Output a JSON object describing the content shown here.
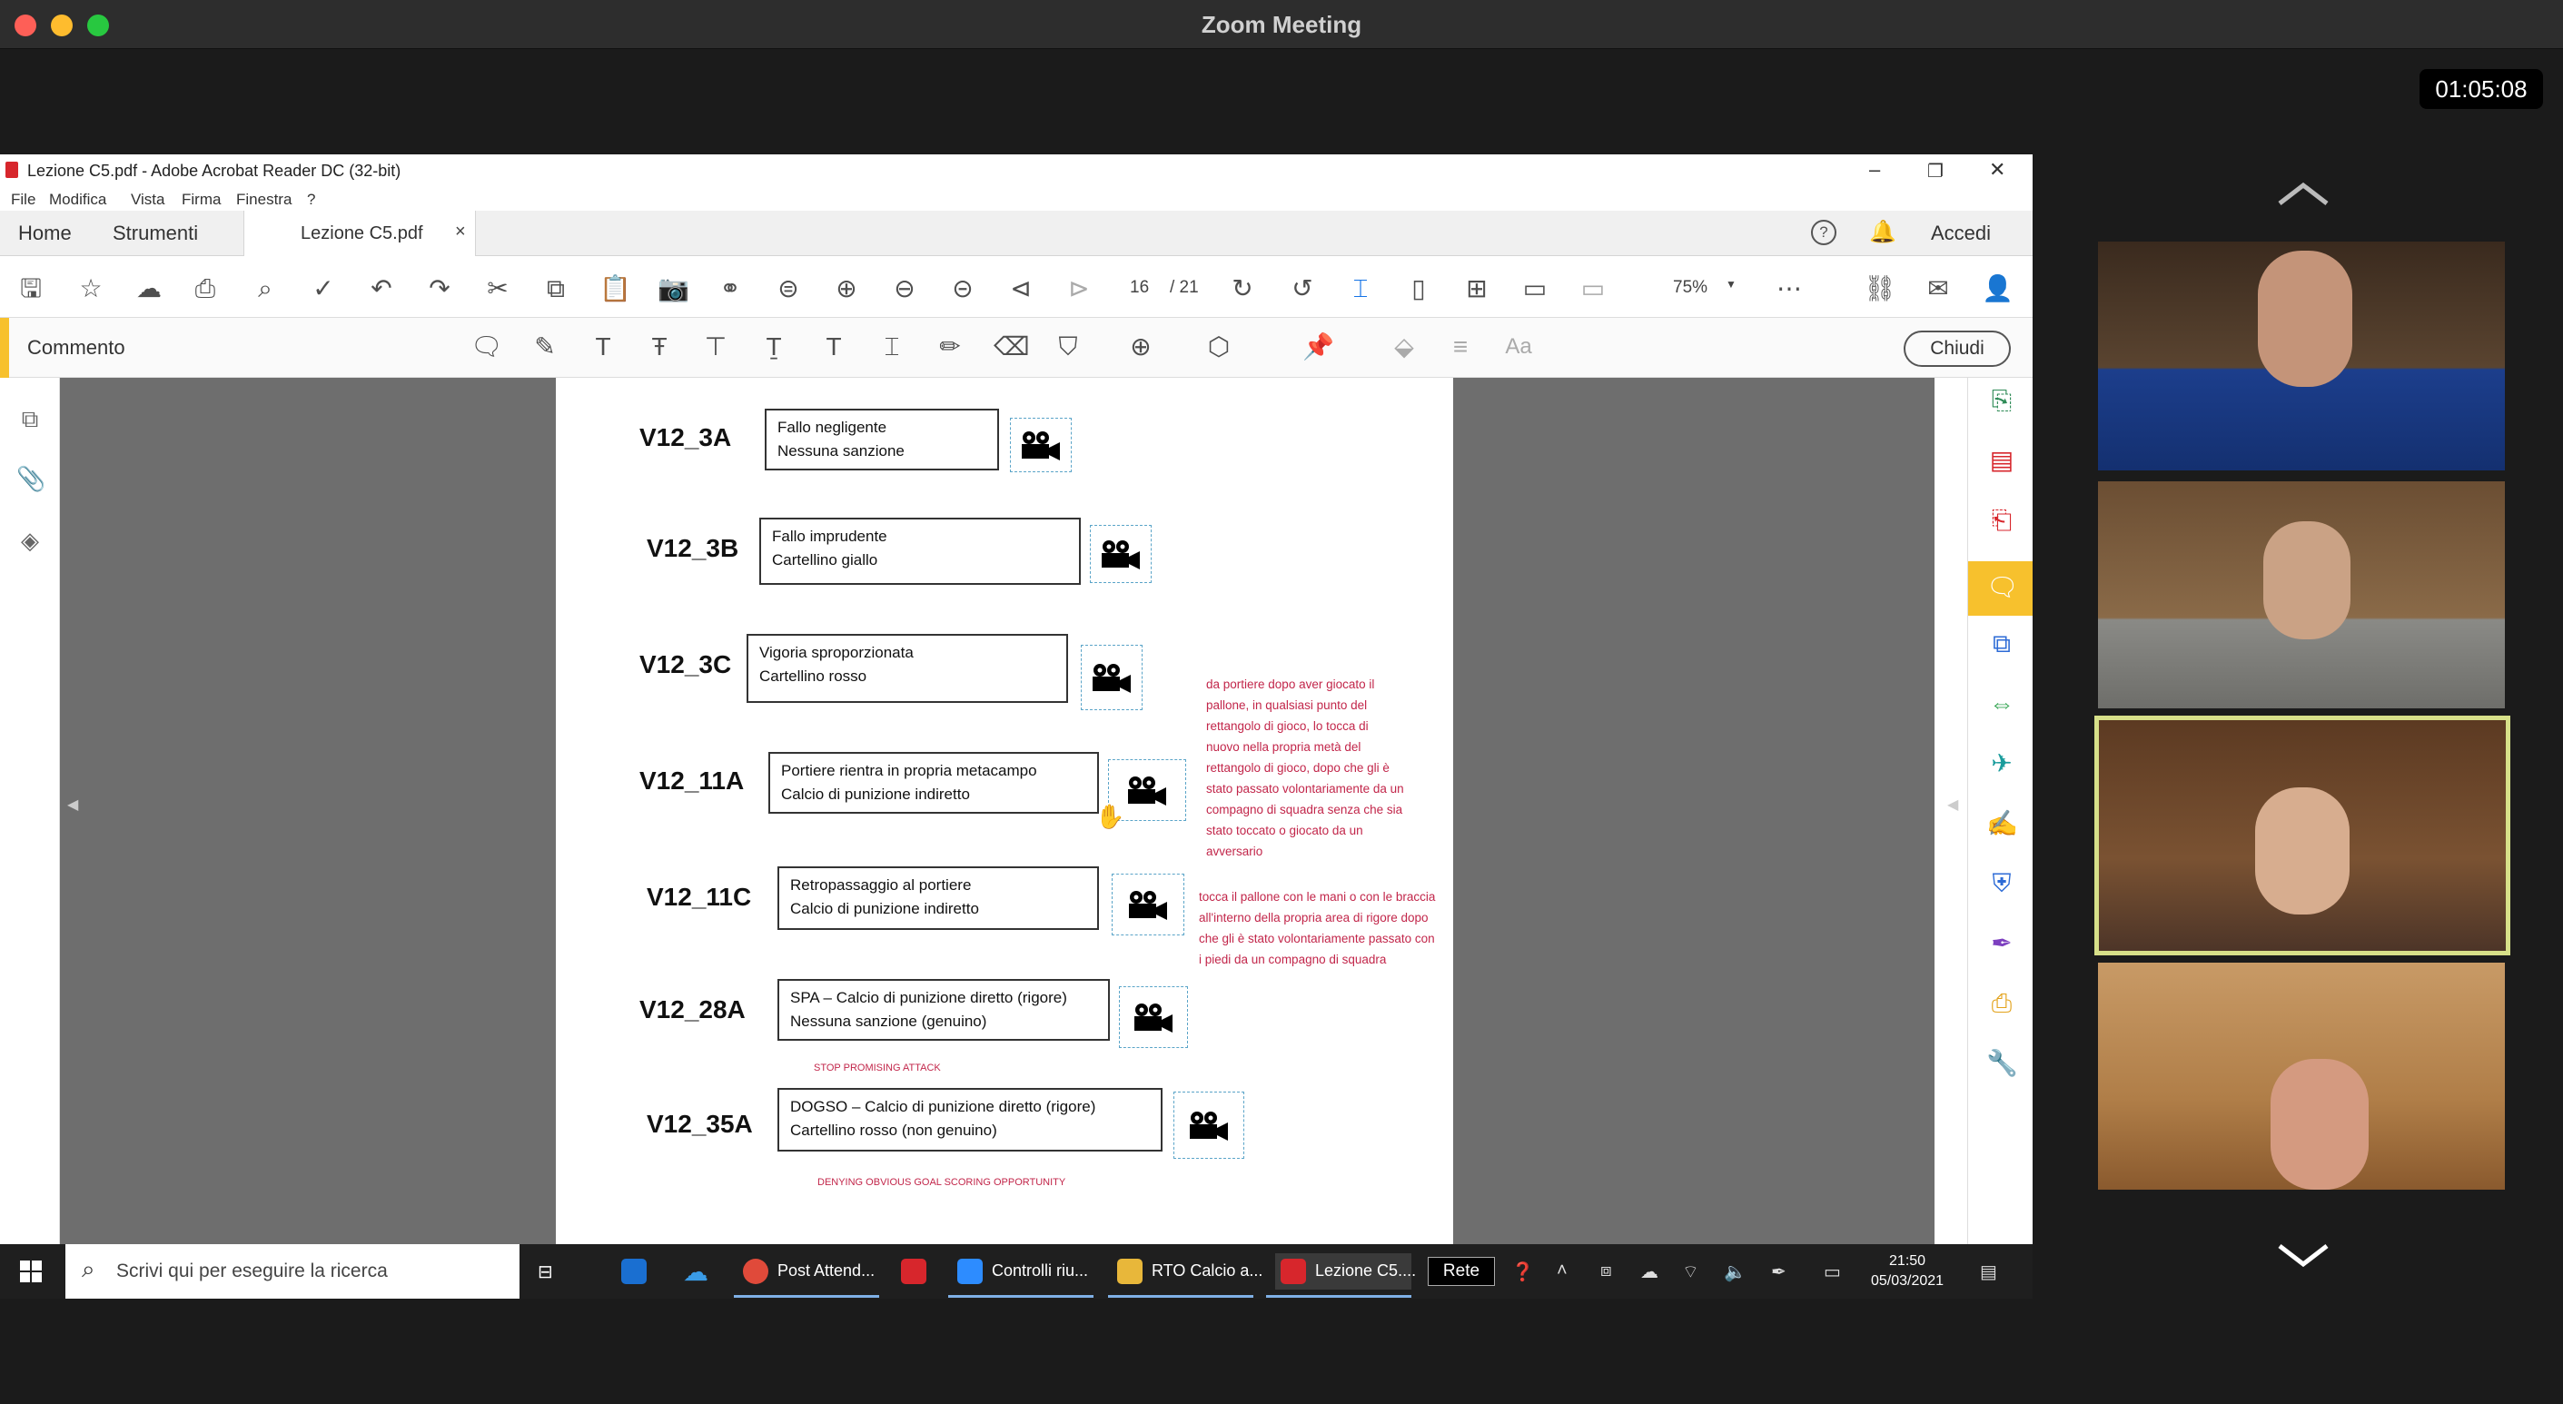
{
  "window": {
    "title": "Zoom Meeting",
    "timer": "01:05:08"
  },
  "acrobat": {
    "title": "Lezione C5.pdf - Adobe Acrobat Reader DC (32-bit)",
    "menu": [
      "File",
      "Modifica",
      "Vista",
      "Firma",
      "Finestra",
      "?"
    ],
    "tabs": {
      "home": "Home",
      "tools": "Strumenti",
      "doc": "Lezione C5.pdf",
      "close": "×"
    },
    "header_right": {
      "signin": "Accedi",
      "help": "?"
    },
    "page_current": "16",
    "page_total": "/ 21",
    "zoom": "75%",
    "comment_label": "Commento",
    "close_button": "Chiudi",
    "icons": {
      "save": "floppy-icon",
      "star": "star-icon",
      "upload": "cloud-upload-icon",
      "print": "printer-icon",
      "search": "magnifier-icon",
      "undo": "undo-icon",
      "redo": "redo-icon"
    }
  },
  "document": {
    "rows": [
      {
        "code": "V12_3A",
        "line1": "Fallo negligente",
        "line2": "Nessuna sanzione"
      },
      {
        "code": "V12_3B",
        "line1": "Fallo imprudente",
        "line2": "Cartellino giallo"
      },
      {
        "code": "V12_3C",
        "line1": "Vigoria sproporzionata",
        "line2": "Cartellino rosso"
      },
      {
        "code": "V12_11A",
        "line1": "Portiere rientra in propria metacampo",
        "line2": "Calcio di punizione indiretto"
      },
      {
        "code": "V12_11C",
        "line1": "Retropassaggio al portiere",
        "line2": "Calcio di punizione indiretto"
      },
      {
        "code": "V12_28A",
        "line1": "SPA – Calcio di punizione diretto (rigore)",
        "line2": "Nessuna sanzione (genuino)",
        "note": "STOP PROMISING ATTACK"
      },
      {
        "code": "V12_35A",
        "line1": "DOGSO – Calcio di punizione diretto (rigore)",
        "line2": "Cartellino rosso (non genuino)",
        "note": "DENYING OBVIOUS GOAL SCORING OPPORTUNITY"
      }
    ],
    "note_11a": [
      "da portiere dopo aver giocato il",
      "pallone, in qualsiasi punto del",
      "rettangolo di gioco, lo tocca di",
      "nuovo nella propria metà del",
      "rettangolo di gioco, dopo che gli è",
      "stato passato volontariamente da un",
      "compagno di squadra senza che sia",
      "stato toccato o giocato da un",
      "avversario"
    ],
    "note_11c": [
      "tocca il pallone con le mani o con le braccia",
      "all'interno della propria area di rigore dopo",
      "che gli è stato volontariamente passato con",
      "i piedi da un compagno di squadra"
    ]
  },
  "taskbar": {
    "search_placeholder": "Scrivi qui per eseguire la ricerca",
    "apps": [
      {
        "label": "Post Attend...",
        "color": "#e04a3a"
      },
      {
        "label": "Controlli riu...",
        "color": "#2d8cff"
      },
      {
        "label": "RTO Calcio a...",
        "color": "#e8b73a"
      },
      {
        "label": "Lezione C5....",
        "color": "#d7262c"
      }
    ],
    "network": "Rete",
    "time": "21:50",
    "date": "05/03/2021"
  },
  "participants": [
    {
      "id": "participant-1",
      "active": false
    },
    {
      "id": "participant-2",
      "active": false
    },
    {
      "id": "participant-3",
      "active": true
    },
    {
      "id": "participant-4",
      "active": false
    }
  ],
  "colors": {
    "active_speaker": "#d7e089",
    "accent": "#f7c12d",
    "note_red": "#c2264a"
  }
}
